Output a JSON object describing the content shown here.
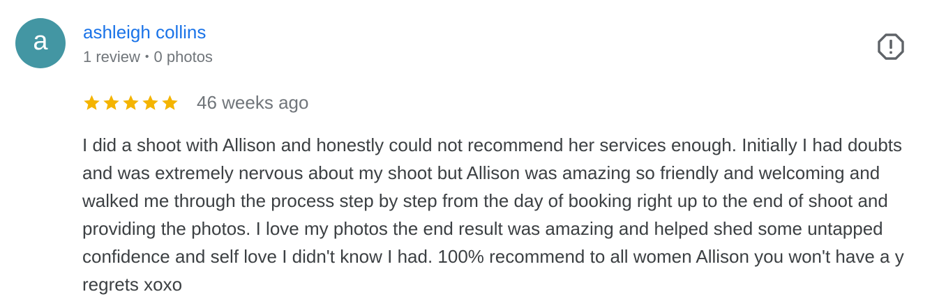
{
  "review": {
    "avatar_letter": "a",
    "author_name": "ashleigh collins",
    "reviews_count": "1 review",
    "separator": "•",
    "photos_count": "0 photos",
    "rating": 5,
    "rating_max": 5,
    "time_ago": "46 weeks ago",
    "text": "I did a shoot with Allison and honestly could not recommend her services enough. Initially I had doubts and was extremely nervous about my shoot but Allison was amazing so friendly and welcoming and walked me through the process step by step from the day of booking right up to the end of shoot and providing the photos. I love my photos the end result was amazing and helped shed some untapped confidence and self love I didn't know I had. 100% recommend to all women Allison you won't have a y regrets xoxo"
  },
  "colors": {
    "avatar_bg": "#4396a3",
    "author_link": "#1a73e8",
    "star": "#f4b400",
    "meta_text": "#70757a",
    "body_text": "#3c4043",
    "report_icon": "#5f6368"
  },
  "icons": {
    "report": "report-flag-icon",
    "star": "star-icon"
  }
}
